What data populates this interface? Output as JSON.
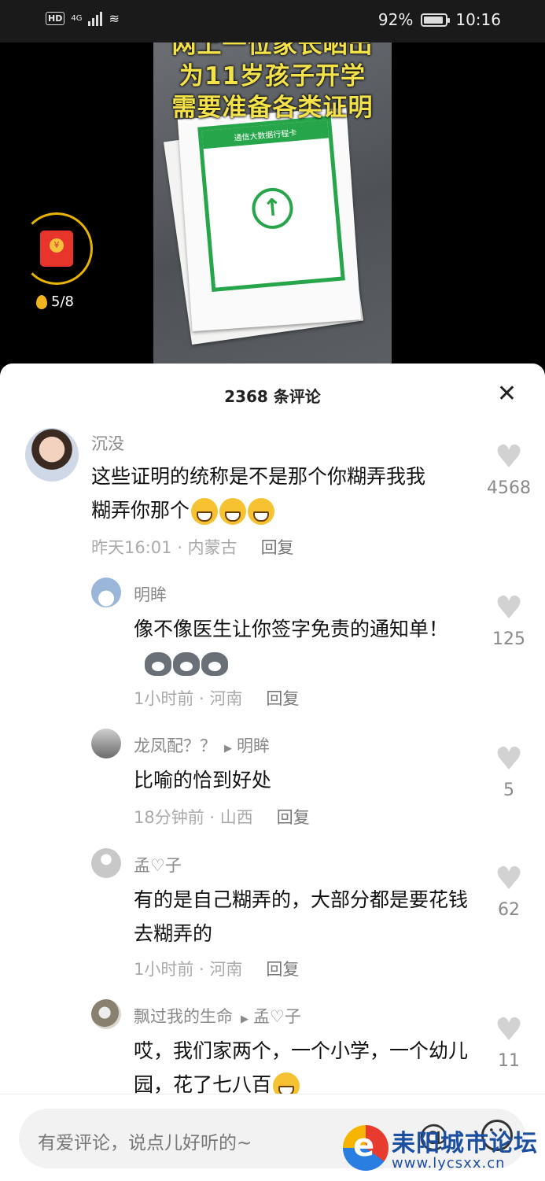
{
  "status_bar": {
    "hd": "HD",
    "network": "4G",
    "battery_percent": "92%",
    "battery_level": 0.92,
    "time": "10:16"
  },
  "video": {
    "overlay_lines": [
      "网上一位家长晒出",
      "为11岁孩子开学",
      "需要准备各类证明"
    ],
    "card_header": "通信大数据行程卡"
  },
  "reward": {
    "progress_text": "5/8",
    "progress_fraction": 0.625
  },
  "sheet": {
    "title": "2368 条评论",
    "close_icon": "close-icon"
  },
  "comments": [
    {
      "author": "沉没",
      "reply_to": "",
      "text": "这些证明的统称是不是那个你糊弄我我糊弄你那个",
      "emoji": "grin-emoji",
      "emoji_count": 3,
      "time": "昨天16:01",
      "location": "内蒙古",
      "reply_label": "回复",
      "likes": "4568"
    },
    {
      "author": "明眸",
      "reply_to": "",
      "text": "像不像医生让你签字免责的通知单！",
      "emoji": "dog-emoji",
      "emoji_count": 3,
      "time": "1小时前",
      "location": "河南",
      "reply_label": "回复",
      "likes": "125"
    },
    {
      "author": "龙凤配？？",
      "reply_to": "明眸",
      "text": "比喻的恰到好处",
      "time": "18分钟前",
      "location": "山西",
      "reply_label": "回复",
      "likes": "5"
    },
    {
      "author": "孟♡子",
      "reply_to": "",
      "text": "有的是自己糊弄的，大部分都是要花钱去糊弄的",
      "time": "1小时前",
      "location": "河南",
      "reply_label": "回复",
      "likes": "62"
    },
    {
      "author": "飘过我的生命",
      "reply_to": "孟♡子",
      "text": "哎，我们家两个，一个小学，一个幼儿园，花了七八百",
      "emoji": "laugh-cry-emoji",
      "time": "",
      "location": "",
      "reply_label": "",
      "likes": "11"
    }
  ],
  "input": {
    "placeholder": "有爱评论，说点儿好听的~",
    "at_icon": "at-icon",
    "emoji_icon": "emoji-icon"
  },
  "watermark": {
    "title": "耒阳城市论坛",
    "url": "www.lycsxx.cn"
  },
  "colors": {
    "overlay_text": "#f3e24a",
    "card_green": "#27a54a",
    "red_packet": "#e8352c"
  }
}
